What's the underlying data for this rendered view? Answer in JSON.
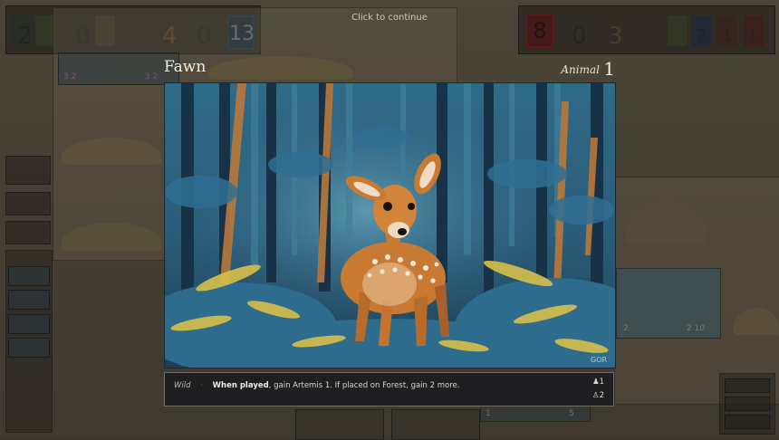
{
  "hint": "Click to continue",
  "card": {
    "title": "Fawn",
    "type": "Animal",
    "cost": "1",
    "category": "Wild",
    "effect_bold": "When played",
    "effect_rest": ", gain Artemis 1. If placed on Forest, gain 2 more.",
    "stat_top": "1",
    "stat_bottom": "2",
    "stat_top_icon": "person-icon",
    "stat_bottom_icon": "person-outline-icon",
    "art_signature": "GOR"
  },
  "left_score": {
    "values": [
      "2",
      "0",
      "4",
      "0",
      "13"
    ],
    "bottom_left": "3  2",
    "bottom_right": "3  2"
  },
  "right_score": {
    "values": [
      "8",
      "0",
      "3",
      "2",
      "1",
      "1",
      "0"
    ]
  },
  "background": {
    "thumb_a_stats": "2",
    "thumb_b_stats": "2  10",
    "thumb_c_stat": "5",
    "thumb_d_stat": "1"
  },
  "colors": {
    "left_accent": "#2b4f74",
    "right_accent": "#7a1c1e",
    "desc_bg": "#1e1e20"
  }
}
